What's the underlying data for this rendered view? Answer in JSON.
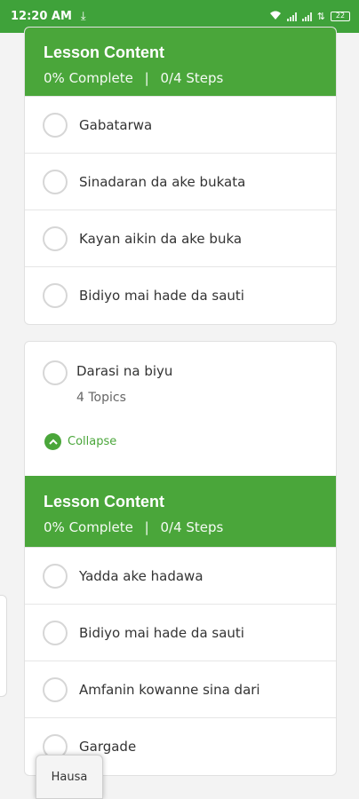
{
  "status_bar": {
    "time": "12:20 AM",
    "battery": "22"
  },
  "section1": {
    "header": {
      "title": "Lesson Content",
      "progress": "0% Complete",
      "separator": "|",
      "steps": "0/4 Steps"
    },
    "items": [
      {
        "label": "Gabatarwa"
      },
      {
        "label": "Sinadaran da ake bukata"
      },
      {
        "label": "Kayan aikin da ake buka"
      },
      {
        "label": "Bidiyo mai hade da sauti"
      }
    ]
  },
  "section2": {
    "title": "Darasi na biyu",
    "subtitle": "4 Topics",
    "collapse_label": "Collapse",
    "header": {
      "title": "Lesson Content",
      "progress": "0% Complete",
      "separator": "|",
      "steps": "0/4 Steps"
    },
    "items": [
      {
        "label": "Yadda ake hadawa"
      },
      {
        "label": "Bidiyo mai hade da sauti"
      },
      {
        "label": "Amfanin kowanne sina dari"
      },
      {
        "label": "Gargade"
      }
    ]
  },
  "language_button": {
    "label": "Hausa"
  },
  "colors": {
    "primary_green": "#4aa63a",
    "status_green": "#3fa23a"
  }
}
